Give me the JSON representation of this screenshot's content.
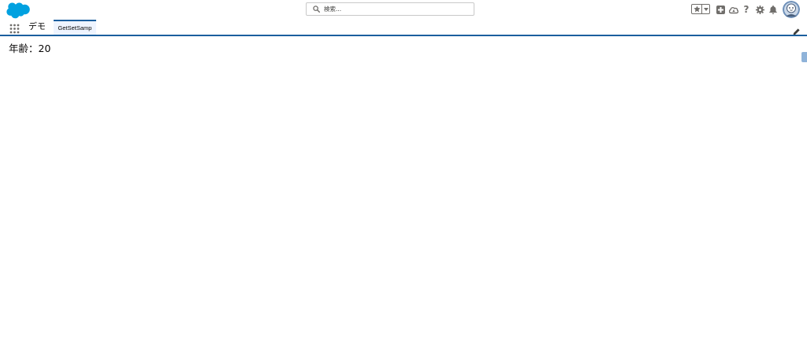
{
  "header": {
    "logo": "salesforce-cloud-logo",
    "search": {
      "placeholder": "検索...",
      "icon": "search-icon"
    },
    "utility": {
      "favorites_icon": "star-icon",
      "favorites_menu_icon": "chevron-down-icon",
      "global_actions_icon": "plus-icon",
      "trailhead_icon": "trailhead-icon",
      "help_label": "?",
      "setup_icon": "gear-icon",
      "notifications_icon": "bell-icon",
      "avatar": "user-avatar"
    }
  },
  "nav": {
    "app_launcher_icon": "waffle-icon",
    "app_name": "デモ",
    "tabs": [
      {
        "label": "GetSetSamp",
        "active": true
      }
    ],
    "edit_icon": "pencil-icon"
  },
  "main": {
    "text": "年齢：20"
  },
  "colors": {
    "brand": "#1b5f9e",
    "logo": "#00a1e0",
    "tab_active_bg": "#eef4ff",
    "icon_gray": "#706e6b"
  }
}
